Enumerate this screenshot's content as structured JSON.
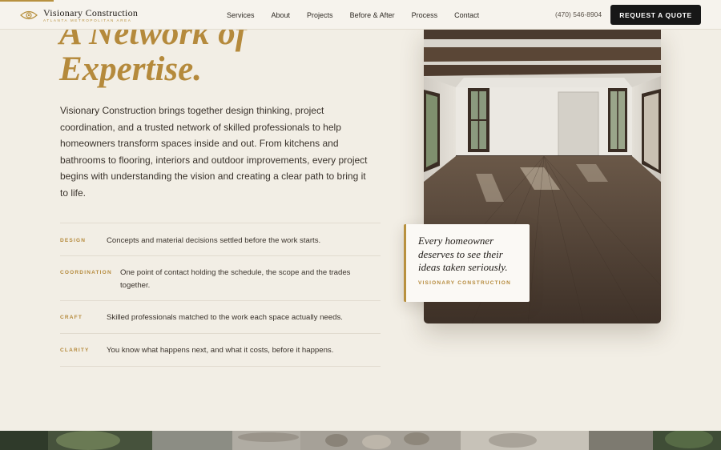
{
  "header": {
    "brand_name": "Visionary Construction",
    "brand_tagline": "ATLANTA METROPOLITAN AREA",
    "nav": [
      "Services",
      "About",
      "Projects",
      "Before & After",
      "Process",
      "Contact"
    ],
    "phone": "(470) 546-8904",
    "cta_label": "REQUEST A QUOTE"
  },
  "hero": {
    "heading": "A Network of\nExpertise.",
    "intro": "Visionary Construction brings together design thinking, project coordination, and a trusted network of skilled professionals to help homeowners transform spaces inside and out. From kitchens and bathrooms to flooring, interiors and outdoor improvements, every project begins with understanding the vision and creating a clear path to bring it to life."
  },
  "features": [
    {
      "tag": "DESIGN",
      "text": "Concepts and material decisions settled before the work starts."
    },
    {
      "tag": "COORDINATION",
      "text": "One point of contact holding the schedule, the scope and the trades together."
    },
    {
      "tag": "CRAFT",
      "text": "Skilled professionals matched to the work each space actually needs."
    },
    {
      "tag": "CLARITY",
      "text": "You know what happens next, and what it costs, before it happens."
    }
  ],
  "quote": {
    "text": "Every homeowner deserves to see their ideas taken seriously.",
    "attribution": "VISIONARY CONSTRUCTION"
  },
  "colors": {
    "accent": "#b58a3c",
    "background": "#f2eee5",
    "cta": "#171717"
  },
  "icons": {
    "logo": "eye-icon"
  }
}
